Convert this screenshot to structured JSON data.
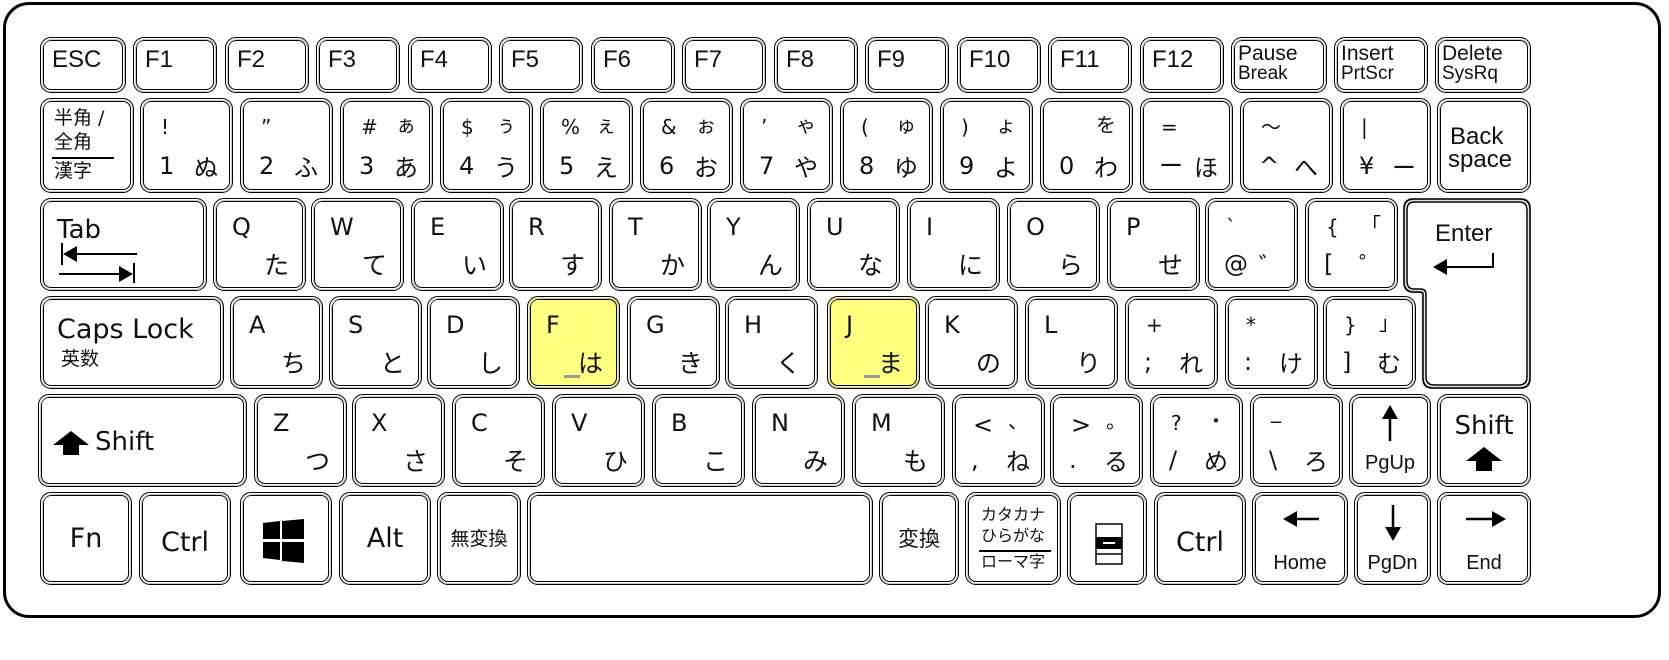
{
  "layout": "Japanese JIS notebook keyboard",
  "highlight_color": "#ffff80",
  "rows": {
    "function": [
      {
        "id": "esc",
        "label": "ESC"
      },
      {
        "id": "f1",
        "label": "F1"
      },
      {
        "id": "f2",
        "label": "F2"
      },
      {
        "id": "f3",
        "label": "F3"
      },
      {
        "id": "f4",
        "label": "F4"
      },
      {
        "id": "f5",
        "label": "F5"
      },
      {
        "id": "f6",
        "label": "F6"
      },
      {
        "id": "f7",
        "label": "F7"
      },
      {
        "id": "f8",
        "label": "F8"
      },
      {
        "id": "f9",
        "label": "F9"
      },
      {
        "id": "f10",
        "label": "F10"
      },
      {
        "id": "f11",
        "label": "F11"
      },
      {
        "id": "f12",
        "label": "F12"
      },
      {
        "id": "pause",
        "label": "Pause",
        "sub": "Break"
      },
      {
        "id": "insert",
        "label": "Insert",
        "sub": "PrtScr"
      },
      {
        "id": "delete",
        "label": "Delete",
        "sub": "SysRq"
      }
    ],
    "number": [
      {
        "id": "hankaku",
        "line1": "半角 /",
        "line2": "全角",
        "line3": "漢字"
      },
      {
        "id": "1",
        "shift": "!",
        "kana_shift": "",
        "base": "1",
        "kana": "ぬ"
      },
      {
        "id": "2",
        "shift": "”",
        "kana_shift": "",
        "base": "2",
        "kana": "ふ"
      },
      {
        "id": "3",
        "shift": "#",
        "kana_shift": "ぁ",
        "base": "3",
        "kana": "あ"
      },
      {
        "id": "4",
        "shift": "$",
        "kana_shift": "ぅ",
        "base": "4",
        "kana": "う"
      },
      {
        "id": "5",
        "shift": "%",
        "kana_shift": "ぇ",
        "base": "5",
        "kana": "え"
      },
      {
        "id": "6",
        "shift": "&",
        "kana_shift": "ぉ",
        "base": "6",
        "kana": "お"
      },
      {
        "id": "7",
        "shift": "’",
        "kana_shift": "ゃ",
        "base": "7",
        "kana": "や"
      },
      {
        "id": "8",
        "shift": "(",
        "kana_shift": "ゅ",
        "base": "8",
        "kana": "ゆ"
      },
      {
        "id": "9",
        "shift": ")",
        "kana_shift": "ょ",
        "base": "9",
        "kana": "よ"
      },
      {
        "id": "0",
        "shift": "",
        "kana_shift": "を",
        "base": "0",
        "kana": "わ"
      },
      {
        "id": "minus",
        "shift": "=",
        "kana_shift": "",
        "base": "ー",
        "kana": "ほ"
      },
      {
        "id": "caret",
        "shift": "〜",
        "kana_shift": "",
        "base": "^",
        "kana": "へ"
      },
      {
        "id": "yen",
        "shift": "|",
        "kana_shift": "",
        "base": "¥",
        "kana": "ー"
      },
      {
        "id": "backspace",
        "line1": "Back",
        "line2": "space"
      }
    ],
    "top_alpha": [
      {
        "id": "tab",
        "label": "Tab"
      },
      {
        "id": "q",
        "letter": "Q",
        "kana": "た"
      },
      {
        "id": "w",
        "letter": "W",
        "kana": "て"
      },
      {
        "id": "e",
        "letter": "E",
        "kana": "い"
      },
      {
        "id": "r",
        "letter": "R",
        "kana": "す"
      },
      {
        "id": "t",
        "letter": "T",
        "kana": "か"
      },
      {
        "id": "y",
        "letter": "Y",
        "kana": "ん"
      },
      {
        "id": "u",
        "letter": "U",
        "kana": "な"
      },
      {
        "id": "i",
        "letter": "I",
        "kana": "に"
      },
      {
        "id": "o",
        "letter": "O",
        "kana": "ら"
      },
      {
        "id": "p",
        "letter": "P",
        "kana": "せ"
      },
      {
        "id": "at",
        "shift": "`",
        "kana_shift": "",
        "base": "@",
        "kana": "゛"
      },
      {
        "id": "lbracket",
        "shift": "{",
        "kana_shift": "「",
        "base": "[",
        "kana": "゜"
      },
      {
        "id": "enter",
        "label": "Enter"
      }
    ],
    "home": [
      {
        "id": "capslock",
        "label": "Caps Lock",
        "sub": "英数"
      },
      {
        "id": "a",
        "letter": "A",
        "kana": "ち"
      },
      {
        "id": "s",
        "letter": "S",
        "kana": "と"
      },
      {
        "id": "d",
        "letter": "D",
        "kana": "し"
      },
      {
        "id": "f",
        "letter": "F",
        "kana": "は",
        "home_position": true
      },
      {
        "id": "g",
        "letter": "G",
        "kana": "き"
      },
      {
        "id": "h",
        "letter": "H",
        "kana": "く"
      },
      {
        "id": "j",
        "letter": "J",
        "kana": "ま",
        "home_position": true
      },
      {
        "id": "k",
        "letter": "K",
        "kana": "の"
      },
      {
        "id": "l",
        "letter": "L",
        "kana": "り"
      },
      {
        "id": "semicolon",
        "shift": "+",
        "kana_shift": "",
        "base": ";",
        "kana": "れ"
      },
      {
        "id": "colon",
        "shift": "*",
        "kana_shift": "",
        "base": ":",
        "kana": "け"
      },
      {
        "id": "rbracket",
        "shift": "}",
        "kana_shift": "」",
        "base": "]",
        "kana": "む"
      }
    ],
    "bottom_alpha": [
      {
        "id": "lshift",
        "label": "Shift"
      },
      {
        "id": "z",
        "letter": "Z",
        "kana": "つ"
      },
      {
        "id": "x",
        "letter": "X",
        "kana": "さ"
      },
      {
        "id": "c",
        "letter": "C",
        "kana": "そ"
      },
      {
        "id": "v",
        "letter": "V",
        "kana": "ひ"
      },
      {
        "id": "b",
        "letter": "B",
        "kana": "こ"
      },
      {
        "id": "n",
        "letter": "N",
        "kana": "み"
      },
      {
        "id": "m",
        "letter": "M",
        "kana": "も"
      },
      {
        "id": "comma",
        "shift": "<",
        "kana_shift": "、",
        "base": ",",
        "kana": "ね"
      },
      {
        "id": "period",
        "shift": ">",
        "kana_shift": "。",
        "base": ".",
        "kana": "る"
      },
      {
        "id": "slash",
        "shift": "?",
        "kana_shift": "・",
        "base": "/",
        "kana": "め"
      },
      {
        "id": "backslash",
        "shift": "_",
        "kana_shift": "",
        "base": "\\",
        "kana": "ろ"
      },
      {
        "id": "pgup",
        "label": "PgUp"
      },
      {
        "id": "rshift",
        "label": "Shift"
      }
    ],
    "modifier": [
      {
        "id": "fn",
        "label": "Fn"
      },
      {
        "id": "lctrl",
        "label": "Ctrl"
      },
      {
        "id": "win",
        "label": ""
      },
      {
        "id": "alt",
        "label": "Alt"
      },
      {
        "id": "muhenkan",
        "label": "無変換"
      },
      {
        "id": "space",
        "label": ""
      },
      {
        "id": "henkan",
        "label": "変換"
      },
      {
        "id": "kana",
        "line1": "カタカナ",
        "line2": "ひらがな",
        "line3": "ローマ字"
      },
      {
        "id": "menu",
        "label": ""
      },
      {
        "id": "rctrl",
        "label": "Ctrl"
      },
      {
        "id": "home",
        "label": "Home"
      },
      {
        "id": "pgdn",
        "label": "PgDn"
      },
      {
        "id": "end",
        "label": "End"
      }
    ]
  }
}
